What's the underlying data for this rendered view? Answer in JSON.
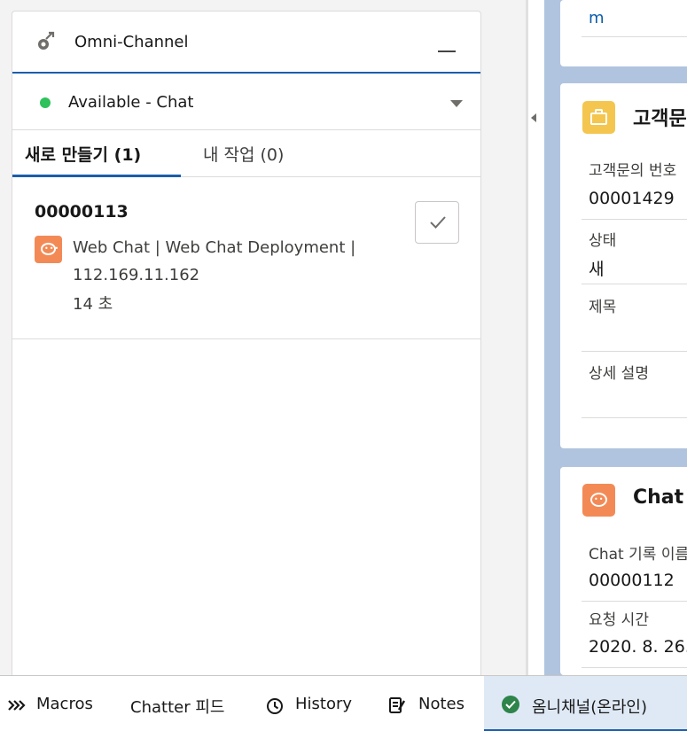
{
  "omni": {
    "title": "Omni-Channel",
    "status": "Available - Chat",
    "tabs": {
      "new": "새로 만들기 (1)",
      "mine": "내 작업 (0)"
    },
    "work_item": {
      "id": "00000113",
      "line1": "Web Chat | Web Chat Deployment |",
      "line2": "112.169.11.162",
      "line3": "14 초"
    }
  },
  "right": {
    "top_card_text": "m",
    "case_card": {
      "title": "고객문",
      "fields": [
        {
          "label": "고객문의 번호",
          "value": "00001429"
        },
        {
          "label": "상태",
          "value": "새"
        },
        {
          "label": "제목",
          "value": ""
        },
        {
          "label": "상세 설명",
          "value": ""
        }
      ]
    },
    "chat_card": {
      "title": "Chat",
      "fields": [
        {
          "label": "Chat 기록 이름",
          "value": "00000112"
        },
        {
          "label": "요청 시간",
          "value": "2020. 8. 26."
        }
      ]
    }
  },
  "utility": {
    "macros": "Macros",
    "chatter": "Chatter 피드",
    "history": "History",
    "notes": "Notes",
    "omni": "옴니채널(온라인)"
  },
  "colors": {
    "brand": "#1b5eab",
    "available": "#2fc15b",
    "chat": "#f38a56",
    "case": "#f4c64f",
    "online": "#2e844a"
  }
}
